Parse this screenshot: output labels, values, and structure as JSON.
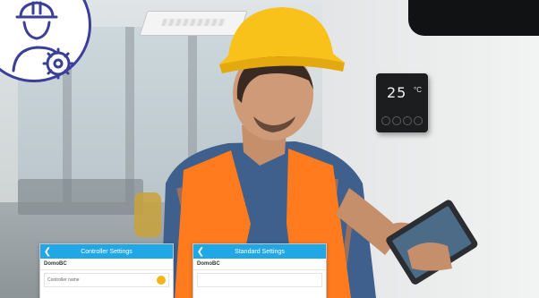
{
  "thermostat": {
    "temperature": "25",
    "unit": "°C"
  },
  "panels": [
    {
      "title": "Controller Settings",
      "brand": "DomoBC",
      "row_label": "Controller name"
    },
    {
      "title": "Standard Settings",
      "brand": "DomoBC",
      "row_label": ""
    }
  ],
  "badge": {
    "icon": "engineer-gear-icon",
    "color": "#3b3f9a"
  },
  "colors": {
    "vest": "#ff7b1e",
    "helmet": "#f8c21a",
    "app_header": "#21a7e6"
  }
}
